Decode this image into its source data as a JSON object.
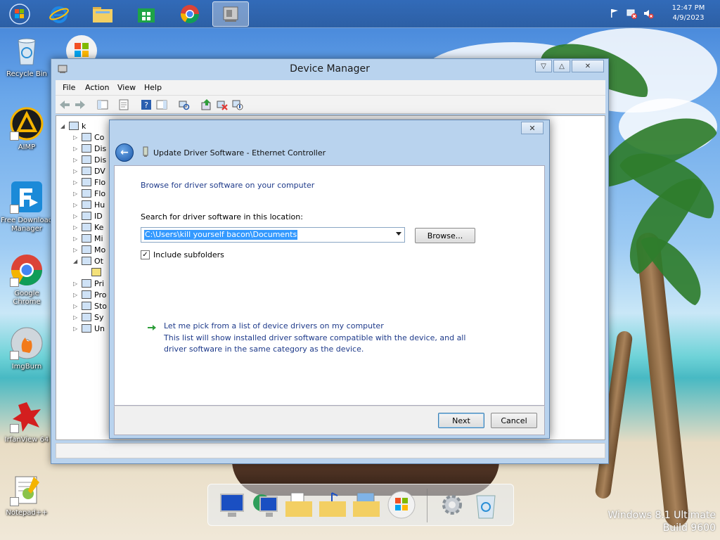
{
  "taskbar": {
    "clock_time": "12:47 PM",
    "clock_date": "4/9/2023",
    "items": [
      {
        "name": "windows-start",
        "icon": "windows-logo-icon"
      },
      {
        "name": "internet-explorer",
        "icon": "ie-icon"
      },
      {
        "name": "file-explorer",
        "icon": "folder-icon"
      },
      {
        "name": "store",
        "icon": "store-icon"
      },
      {
        "name": "chrome",
        "icon": "chrome-icon"
      },
      {
        "name": "device-manager",
        "icon": "device-manager-icon"
      }
    ]
  },
  "desktop_icons": [
    {
      "label": "Recycle Bin"
    },
    {
      "label": "AIMP"
    },
    {
      "label": "Free Download Manager"
    },
    {
      "label": "Google Chrome"
    },
    {
      "label": "ImgBurn"
    },
    {
      "label": "IrfanView 64"
    },
    {
      "label": "Notepad++"
    }
  ],
  "device_manager": {
    "title": "Device Manager",
    "menu": [
      "File",
      "Action",
      "View",
      "Help"
    ],
    "tree_root": "k",
    "tree_items": [
      "Co",
      "Dis",
      "Dis",
      "DV",
      "Flo",
      "Flo",
      "Hu",
      "ID",
      "Ke",
      "Mi",
      "Mo",
      "Ot",
      "",
      "Pri",
      "Pro",
      "Sto",
      "Sy",
      "Un"
    ]
  },
  "dialog": {
    "header": "Update Driver Software - Ethernet Controller",
    "heading": "Browse for driver software on your computer",
    "search_label": "Search for driver software in this location:",
    "path_value": "C:\\Users\\kill yourself bacon\\Documents",
    "browse_label": "Browse...",
    "include_subfolders_label": "Include subfolders",
    "include_subfolders_checked": "✓",
    "pick_title": "Let me pick from a list of device drivers on my computer",
    "pick_desc": "This list will show installed driver software compatible with the device, and all driver software in the same category as the device.",
    "next_label": "Next",
    "cancel_label": "Cancel"
  },
  "watermark": {
    "line1": "Windows 8.1 Ultimate",
    "line2": "Build 9600"
  },
  "colors": {
    "accent": "#1a56a8",
    "heading": "#1e3a8a",
    "selection": "#3399ff",
    "window_frame": "#b9d3ee"
  }
}
